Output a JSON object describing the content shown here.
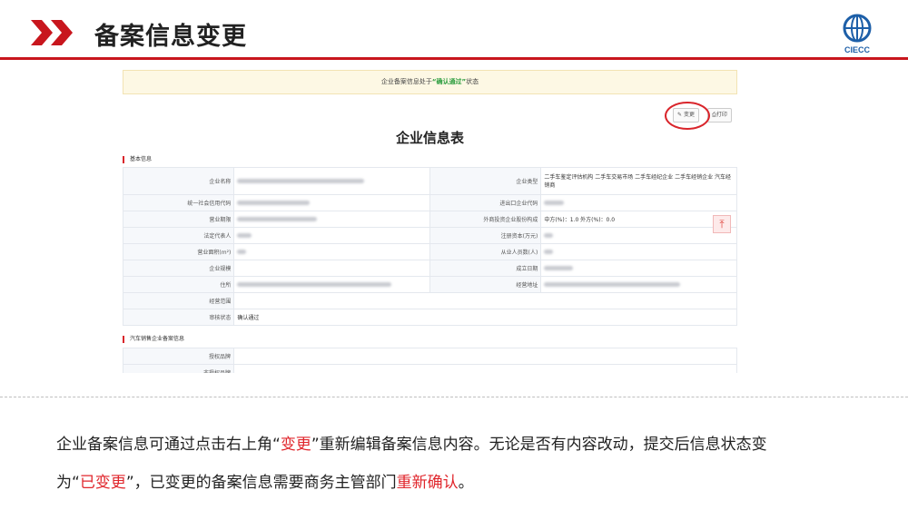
{
  "slide": {
    "title": "备案信息变更",
    "logo_text": "CIECC",
    "brand_red": "#c8161d",
    "brand_blue": "#1d5fa8",
    "chevron_icon": "double-chevron-right-icon"
  },
  "screenshot": {
    "notice": {
      "prefix": "企业备案信息处于",
      "status": "“确认通过”",
      "suffix": "状态"
    },
    "buttons": {
      "change": "变更",
      "print": "打印"
    },
    "form_title": "企业信息表",
    "section_basic": "基本信息",
    "rows": {
      "company_name": "企业名称",
      "company_type": "企业类型",
      "company_type_value": "二手车鉴定评估机构 二手车交易市场 二手车经纪企业 二手车经销企业 汽车经销商",
      "credit_code": "统一社会信用代码",
      "import_export_code": "进出口企业代码",
      "business_term": "营业期限",
      "foreign_investment": "外商投资企业股份构成",
      "foreign_investment_value": "中方(%)：1.0   外方(%)：0.0",
      "legal_rep": "法定代表人",
      "registered_capital": "注册资本(万元)",
      "business_area": "营业面积(m²)",
      "employees": "从业人员数(人)",
      "company_scale": "企业规模",
      "established": "成立日期",
      "address": "住所",
      "business_address": "经营地址",
      "scope": "经营范围",
      "audit_status": "审核状态",
      "audit_status_value": "确认通过"
    },
    "section_auto": "汽车销售企业备案信息",
    "rows2": {
      "brand": "授权品牌",
      "non_brand": "非授权品牌"
    },
    "scroll_top_icon": "arrow-up-to-top-icon"
  },
  "caption": {
    "line1_a": "企业备案信息可通过点击右上角",
    "line1_q1": "“",
    "line1_red": "变更",
    "line1_q2": "”",
    "line1_b": "重新编辑备案信息内容。无论是否有内容改动，提交后信息状态变",
    "line2_a": "为",
    "line2_q1": "“",
    "line2_red": "已变更",
    "line2_q2": "”",
    "line2_b": "，已变更的备案信息需要商务主管部门",
    "line2_red2": "重新确认",
    "line2_c": "。"
  }
}
